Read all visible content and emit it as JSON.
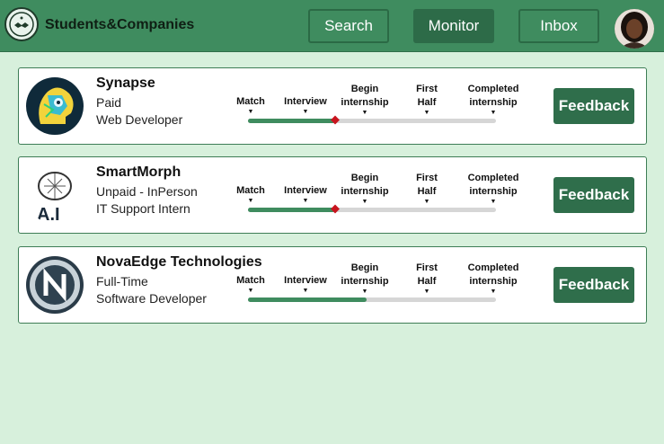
{
  "header": {
    "brand": "Students&Companies",
    "nav": {
      "search": "Search",
      "monitor": "Monitor",
      "inbox": "Inbox"
    }
  },
  "stages": [
    "Match",
    "Interview",
    "Begin internship",
    "First Half",
    "Completed internship"
  ],
  "cards": [
    {
      "company": "Synapse",
      "line1": "Paid",
      "line2": "Web Developer",
      "progress_percent": 35,
      "current_marker": true,
      "feedback_label": "Feedback"
    },
    {
      "company": "SmartMorph",
      "line1": "Unpaid - InPerson",
      "line2": "IT Support Intern",
      "progress_percent": 35,
      "current_marker": true,
      "feedback_label": "Feedback"
    },
    {
      "company": "NovaEdge Technologies",
      "line1": "Full-Time",
      "line2": "Software Developer",
      "progress_percent": 48,
      "current_marker": false,
      "feedback_label": "Feedback"
    }
  ],
  "colors": {
    "accent": "#3f8c5f",
    "accent_dark": "#2f6e4b",
    "background": "#d7f0dc",
    "marker": "#c8141e"
  }
}
